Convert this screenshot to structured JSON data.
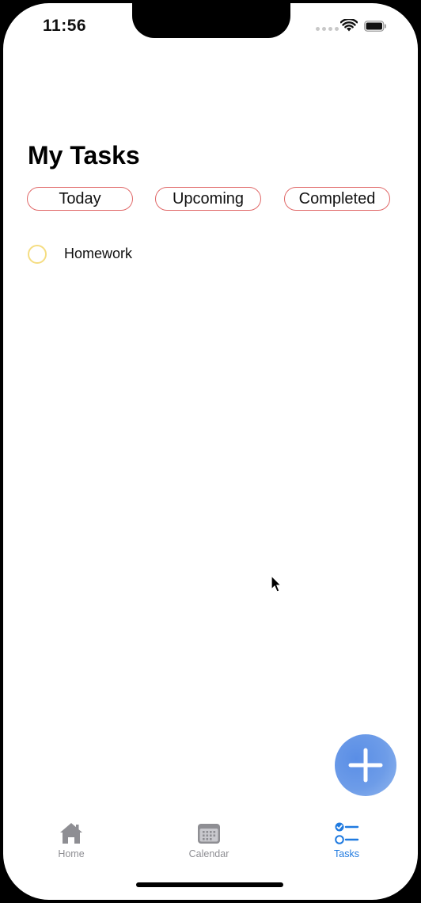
{
  "status_bar": {
    "time": "11:56"
  },
  "page": {
    "title": "My Tasks"
  },
  "filters": [
    {
      "label": "Today"
    },
    {
      "label": "Upcoming"
    },
    {
      "label": "Completed"
    }
  ],
  "tasks": [
    {
      "label": "Homework",
      "completed": false,
      "circle_color": "#f5dd82"
    }
  ],
  "fab": {
    "icon": "plus-icon",
    "color": "#5a8ee6"
  },
  "tabbar": {
    "active_color": "#1f7ae0",
    "inactive_color": "#8e8e93",
    "items": [
      {
        "label": "Home",
        "icon": "house-icon",
        "active": false
      },
      {
        "label": "Calendar",
        "icon": "calendar-icon",
        "active": false
      },
      {
        "label": "Tasks",
        "icon": "checklist-icon",
        "active": true
      }
    ]
  },
  "colors": {
    "filter_border": "#e06868",
    "background": "#ffffff"
  }
}
